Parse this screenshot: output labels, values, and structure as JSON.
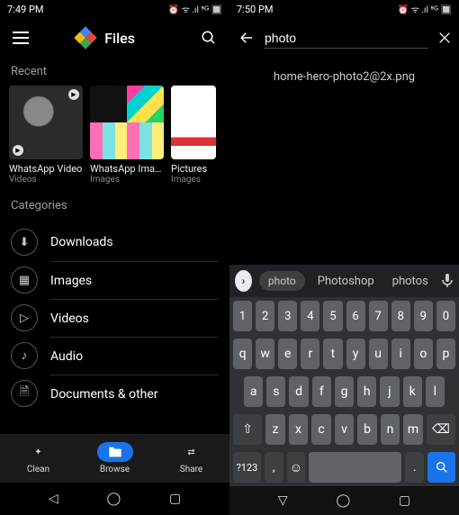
{
  "left": {
    "status_time": "7:49 PM",
    "status_right": "⏰ ᯤ .ıl ⁵ᴳ 🔲",
    "app_title": "Files",
    "section_recent": "Recent",
    "recent": [
      {
        "title": "WhatsApp Video",
        "sub": "Videos"
      },
      {
        "title": "WhatsApp Images",
        "sub": "Images"
      },
      {
        "title": "Pictures",
        "sub": "Images"
      }
    ],
    "section_categories": "Categories",
    "categories": [
      {
        "icon": "⬇",
        "label": "Downloads"
      },
      {
        "icon": "▦",
        "label": "Images"
      },
      {
        "icon": "▷",
        "label": "Videos"
      },
      {
        "icon": "♪",
        "label": "Audio"
      },
      {
        "icon": "🗎",
        "label": "Documents & other"
      }
    ],
    "nav": {
      "clean": "Clean",
      "browse": "Browse",
      "share": "Share"
    }
  },
  "right": {
    "status_time": "7:50 PM",
    "status_right": "⏰ ᯤ .ıl ⁵ᴳ 🔲",
    "search_value": "photo",
    "result": "home-hero-photo2@2x.png",
    "suggestions": {
      "main": "photo",
      "s2": "Photoshop",
      "s3": "photos"
    },
    "keys": {
      "row1": [
        "1",
        "2",
        "3",
        "4",
        "5",
        "6",
        "7",
        "8",
        "9",
        "0"
      ],
      "row2": [
        "q",
        "w",
        "e",
        "r",
        "t",
        "y",
        "u",
        "i",
        "o",
        "p"
      ],
      "row3": [
        "a",
        "s",
        "d",
        "f",
        "g",
        "h",
        "j",
        "k",
        "l"
      ],
      "row4_shift": "⇧",
      "row4": [
        "z",
        "x",
        "c",
        "v",
        "b",
        "n",
        "m"
      ],
      "row4_del": "⌫",
      "sym": "?123",
      "comma": ",",
      "emoji": "☺",
      "period": ".",
      "search_icon": "🔍"
    }
  }
}
